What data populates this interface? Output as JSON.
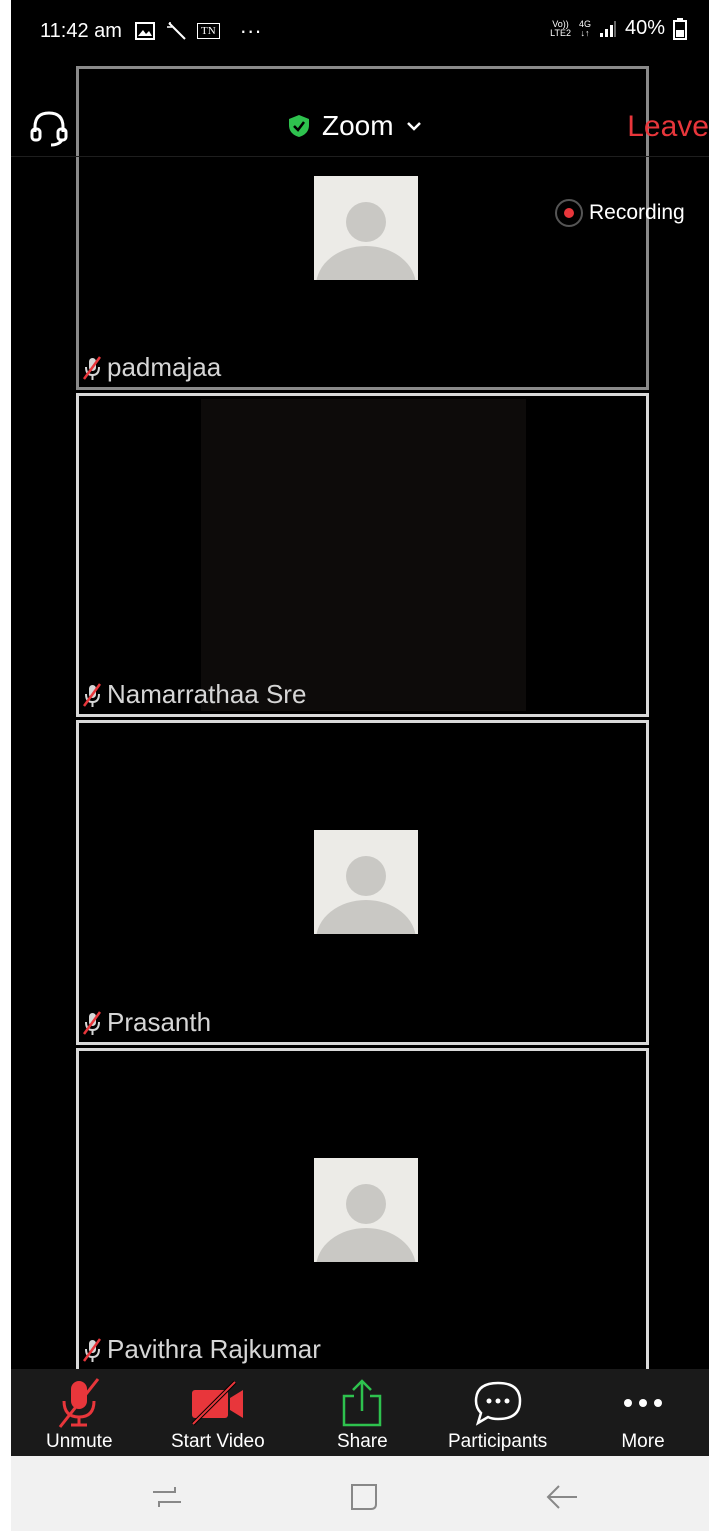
{
  "status_bar": {
    "time": "11:42 am",
    "battery": "40%",
    "network_top": "Vo))",
    "network_bottom": "LTE2",
    "gen_top": "4G",
    "gen_bottom": "↓↑",
    "sim_badge": "TN",
    "more": "···"
  },
  "header": {
    "title": "Zoom",
    "leave_label": "Leave",
    "recording_label": "Recording"
  },
  "participants": [
    {
      "name": "padmajaa",
      "muted": true,
      "video": false
    },
    {
      "name": "Namarrathaa Sre",
      "muted": true,
      "video": true
    },
    {
      "name": "Prasanth",
      "muted": true,
      "video": false
    },
    {
      "name": "Pavithra Rajkumar",
      "muted": true,
      "video": false
    }
  ],
  "toolbar": {
    "unmute_label": "Unmute",
    "start_video_label": "Start Video",
    "share_label": "Share",
    "participants_label": "Participants",
    "more_label": "More"
  },
  "colors": {
    "leave": "#e8363b",
    "share": "#2ec24e",
    "shield": "#2ec24e",
    "muted_icon": "#e8363b"
  }
}
